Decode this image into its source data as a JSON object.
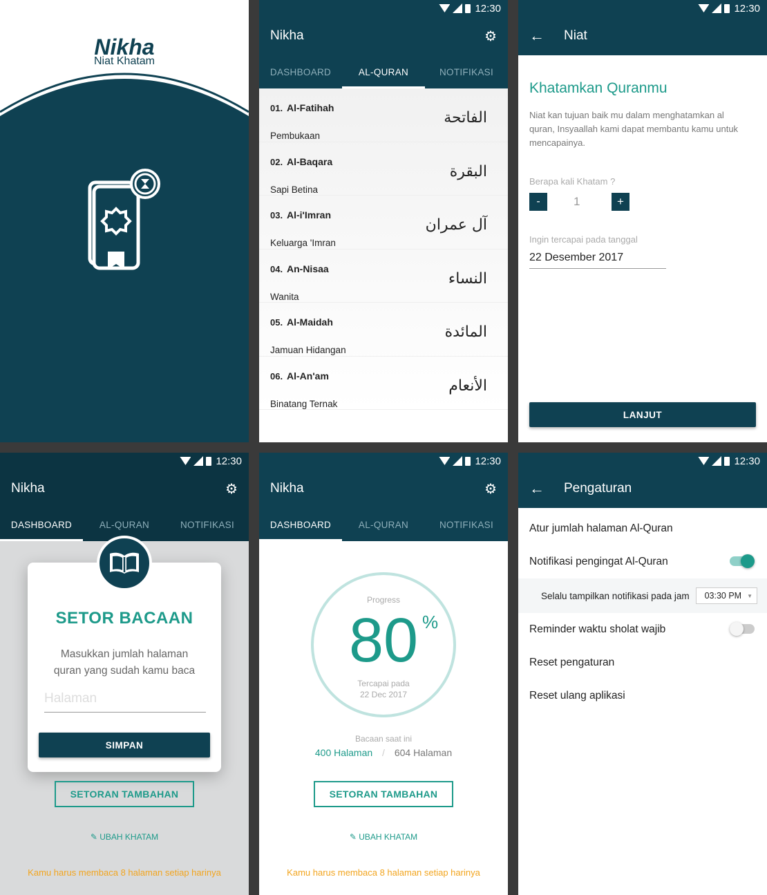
{
  "status": {
    "time": "12:30"
  },
  "splash": {
    "logo_title": "Nikha",
    "logo_subtitle": "Niat Khatam"
  },
  "app_title": "Nikha",
  "tabs": [
    "DASHBOARD",
    "AL-QURAN",
    "NOTIFIKASI"
  ],
  "quran_list": [
    {
      "num": "01.",
      "name": "Al-Fatihah",
      "meaning": "Pembukaan",
      "arabic": "الفاتحة"
    },
    {
      "num": "02.",
      "name": "Al-Baqara",
      "meaning": "Sapi Betina",
      "arabic": "البقرة"
    },
    {
      "num": "03.",
      "name": "Al-i'Imran",
      "meaning": "Keluarga 'Imran",
      "arabic": "آل عمران"
    },
    {
      "num": "04.",
      "name": "An-Nisaa",
      "meaning": "Wanita",
      "arabic": "النساء"
    },
    {
      "num": "05.",
      "name": "Al-Maidah",
      "meaning": "Jamuan Hidangan",
      "arabic": "المائدة"
    },
    {
      "num": "06.",
      "name": "Al-An'am",
      "meaning": "Binatang Ternak",
      "arabic": "الأنعام"
    }
  ],
  "niat": {
    "title": "Niat",
    "heading": "Khatamkan Quranmu",
    "description": "Niat kan tujuan baik mu dalam menghatamkan al quran, Insyaallah kami dapat membantu kamu untuk mencapainya.",
    "khatam_label": "Berapa kali Khatam ?",
    "minus": "-",
    "plus": "+",
    "khatam_value": "1",
    "date_label": "Ingin tercapai pada tanggal",
    "date_value": "22 Desember 2017",
    "next_button": "LANJUT"
  },
  "setor": {
    "title": "SETOR BACAAN",
    "description": "Masukkan jumlah halaman quran yang sudah kamu baca",
    "input_placeholder": "Halaman",
    "save_button": "SIMPAN"
  },
  "dashboard": {
    "progress_label": "Progress",
    "progress_value": "80",
    "progress_percent": 80,
    "percent_sign": "%",
    "reached_label": "Tercapai pada",
    "reached_date": "22 Dec 2017",
    "reading_label": "Bacaan saat ini",
    "current_pages": "400 Halaman",
    "separator": "/",
    "total_pages": "604 Halaman",
    "extra_button": "SETORAN TAMBAHAN",
    "edit_link": "UBAH KHATAM",
    "daily_note": "Kamu harus membaca 8 halaman setiap harinya"
  },
  "settings": {
    "title": "Pengaturan",
    "rows": [
      "Atur jumlah halaman Al-Quran",
      "Notifikasi pengingat Al-Quran",
      "Reminder waktu sholat wajib",
      "Reset pengaturan",
      "Reset ulang aplikasi"
    ],
    "notif_time_label": "Selalu tampilkan notifikasi pada jam",
    "notif_time_value": "03:30 PM",
    "notif_enabled": true,
    "reminder_enabled": false
  },
  "colors": {
    "primary": "#0f4152",
    "accent": "#1d9a8a",
    "warning": "#f2a51f"
  }
}
